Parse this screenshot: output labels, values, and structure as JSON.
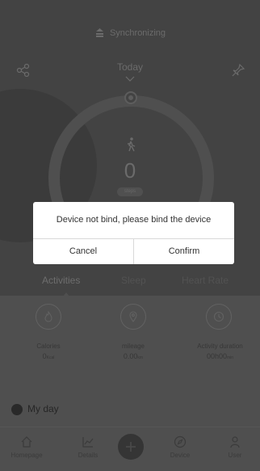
{
  "header": {
    "sync_label": "Synchronizing",
    "date_label": "Today"
  },
  "ring": {
    "steps_value": "0",
    "steps_unit": "steps"
  },
  "tabs": [
    {
      "label": "Activities",
      "active": true
    },
    {
      "label": "Sleep",
      "active": false
    },
    {
      "label": "Heart Rate",
      "active": false
    }
  ],
  "stats": [
    {
      "label": "Calories",
      "value": "0",
      "unit": "Kcal"
    },
    {
      "label": "mileage",
      "value": "0.00",
      "unit": "km"
    },
    {
      "label": "Activity duration",
      "value": "00h00",
      "unit": "min"
    }
  ],
  "myday": {
    "label": "My day"
  },
  "nav": [
    {
      "label": "Homepage",
      "icon": "home-icon"
    },
    {
      "label": "Details",
      "icon": "chart-icon"
    },
    {
      "label": "",
      "icon": "plus-icon"
    },
    {
      "label": "Device",
      "icon": "compass-icon"
    },
    {
      "label": "User",
      "icon": "user-icon"
    }
  ],
  "dialog": {
    "message": "Device not bind, please bind the device",
    "cancel_label": "Cancel",
    "confirm_label": "Confirm"
  },
  "colors": {
    "dialog_bg": "#ffffff",
    "screen_dark": "#4d4d4d",
    "screen_light": "#5a5a5a"
  }
}
